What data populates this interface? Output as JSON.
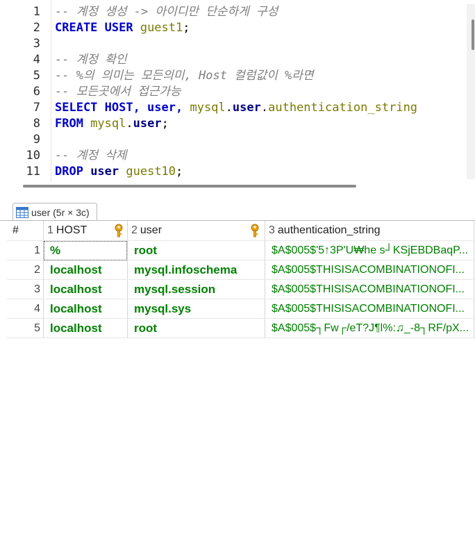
{
  "editor": {
    "lines": [
      {
        "num": "1",
        "tokens": [
          {
            "t": "-- 계정 생성 -> 아이디만 단순하게 구성",
            "c": "cm"
          }
        ]
      },
      {
        "num": "2",
        "tokens": [
          {
            "t": "CREATE USER ",
            "c": "kw"
          },
          {
            "t": "guest1",
            "c": "ol"
          },
          {
            "t": ";",
            "c": "pl"
          }
        ]
      },
      {
        "num": "3",
        "tokens": []
      },
      {
        "num": "4",
        "tokens": [
          {
            "t": "-- 계정 확인",
            "c": "cm"
          }
        ]
      },
      {
        "num": "5",
        "tokens": [
          {
            "t": "-- %의 의미는 모든의미, Host 컬럼값이 %라면",
            "c": "cm"
          }
        ]
      },
      {
        "num": "6",
        "tokens": [
          {
            "t": "-- 모든곳에서 접근가능",
            "c": "cm"
          }
        ]
      },
      {
        "num": "7",
        "tokens": [
          {
            "t": "SELECT HOST, user, ",
            "c": "kw"
          },
          {
            "t": "mysql",
            "c": "ol"
          },
          {
            "t": ".",
            "c": "pl"
          },
          {
            "t": "user",
            "c": "id"
          },
          {
            "t": ".",
            "c": "pl"
          },
          {
            "t": "authentication_string",
            "c": "ol"
          }
        ]
      },
      {
        "num": "8",
        "tokens": [
          {
            "t": "FROM ",
            "c": "kw"
          },
          {
            "t": "mysql",
            "c": "ol"
          },
          {
            "t": ".",
            "c": "pl"
          },
          {
            "t": "user",
            "c": "id"
          },
          {
            "t": ";",
            "c": "pl"
          }
        ]
      },
      {
        "num": "9",
        "tokens": []
      },
      {
        "num": "10",
        "tokens": [
          {
            "t": "-- 계정 삭제",
            "c": "cm"
          }
        ]
      },
      {
        "num": "11",
        "tokens": [
          {
            "t": "DROP ",
            "c": "kw"
          },
          {
            "t": "user ",
            "c": "id"
          },
          {
            "t": "guest10",
            "c": "ol"
          },
          {
            "t": ";",
            "c": "pl"
          }
        ]
      }
    ]
  },
  "result_tab": {
    "label": "user (5r × 3c)",
    "icon": "table-grid-icon"
  },
  "grid": {
    "rownum_header": "#",
    "columns": [
      {
        "num": "1",
        "name": "HOST",
        "key": true
      },
      {
        "num": "2",
        "name": "user",
        "key": true
      },
      {
        "num": "3",
        "name": "authentication_string",
        "key": false
      }
    ],
    "rows": [
      {
        "n": "1",
        "host": "%",
        "user": "root",
        "auth": "$A$005$'5↑3P'U₩he s┘KSjEBDBaqP..."
      },
      {
        "n": "2",
        "host": "localhost",
        "user": "mysql.infoschema",
        "auth": "$A$005$THISISACOMBINATIONOFI..."
      },
      {
        "n": "3",
        "host": "localhost",
        "user": "mysql.session",
        "auth": "$A$005$THISISACOMBINATIONOFI..."
      },
      {
        "n": "4",
        "host": "localhost",
        "user": "mysql.sys",
        "auth": "$A$005$THISISACOMBINATIONOFI..."
      },
      {
        "n": "5",
        "host": "localhost",
        "user": "root",
        "auth": "$A$005$┐Fw┌/eT?J¶l%:♫_-8┐RF/pX..."
      }
    ]
  },
  "colors": {
    "keyword": "#0000cc",
    "comment": "#7f7f7f",
    "cell_text": "#008000",
    "key_icon": "#e8a317"
  }
}
